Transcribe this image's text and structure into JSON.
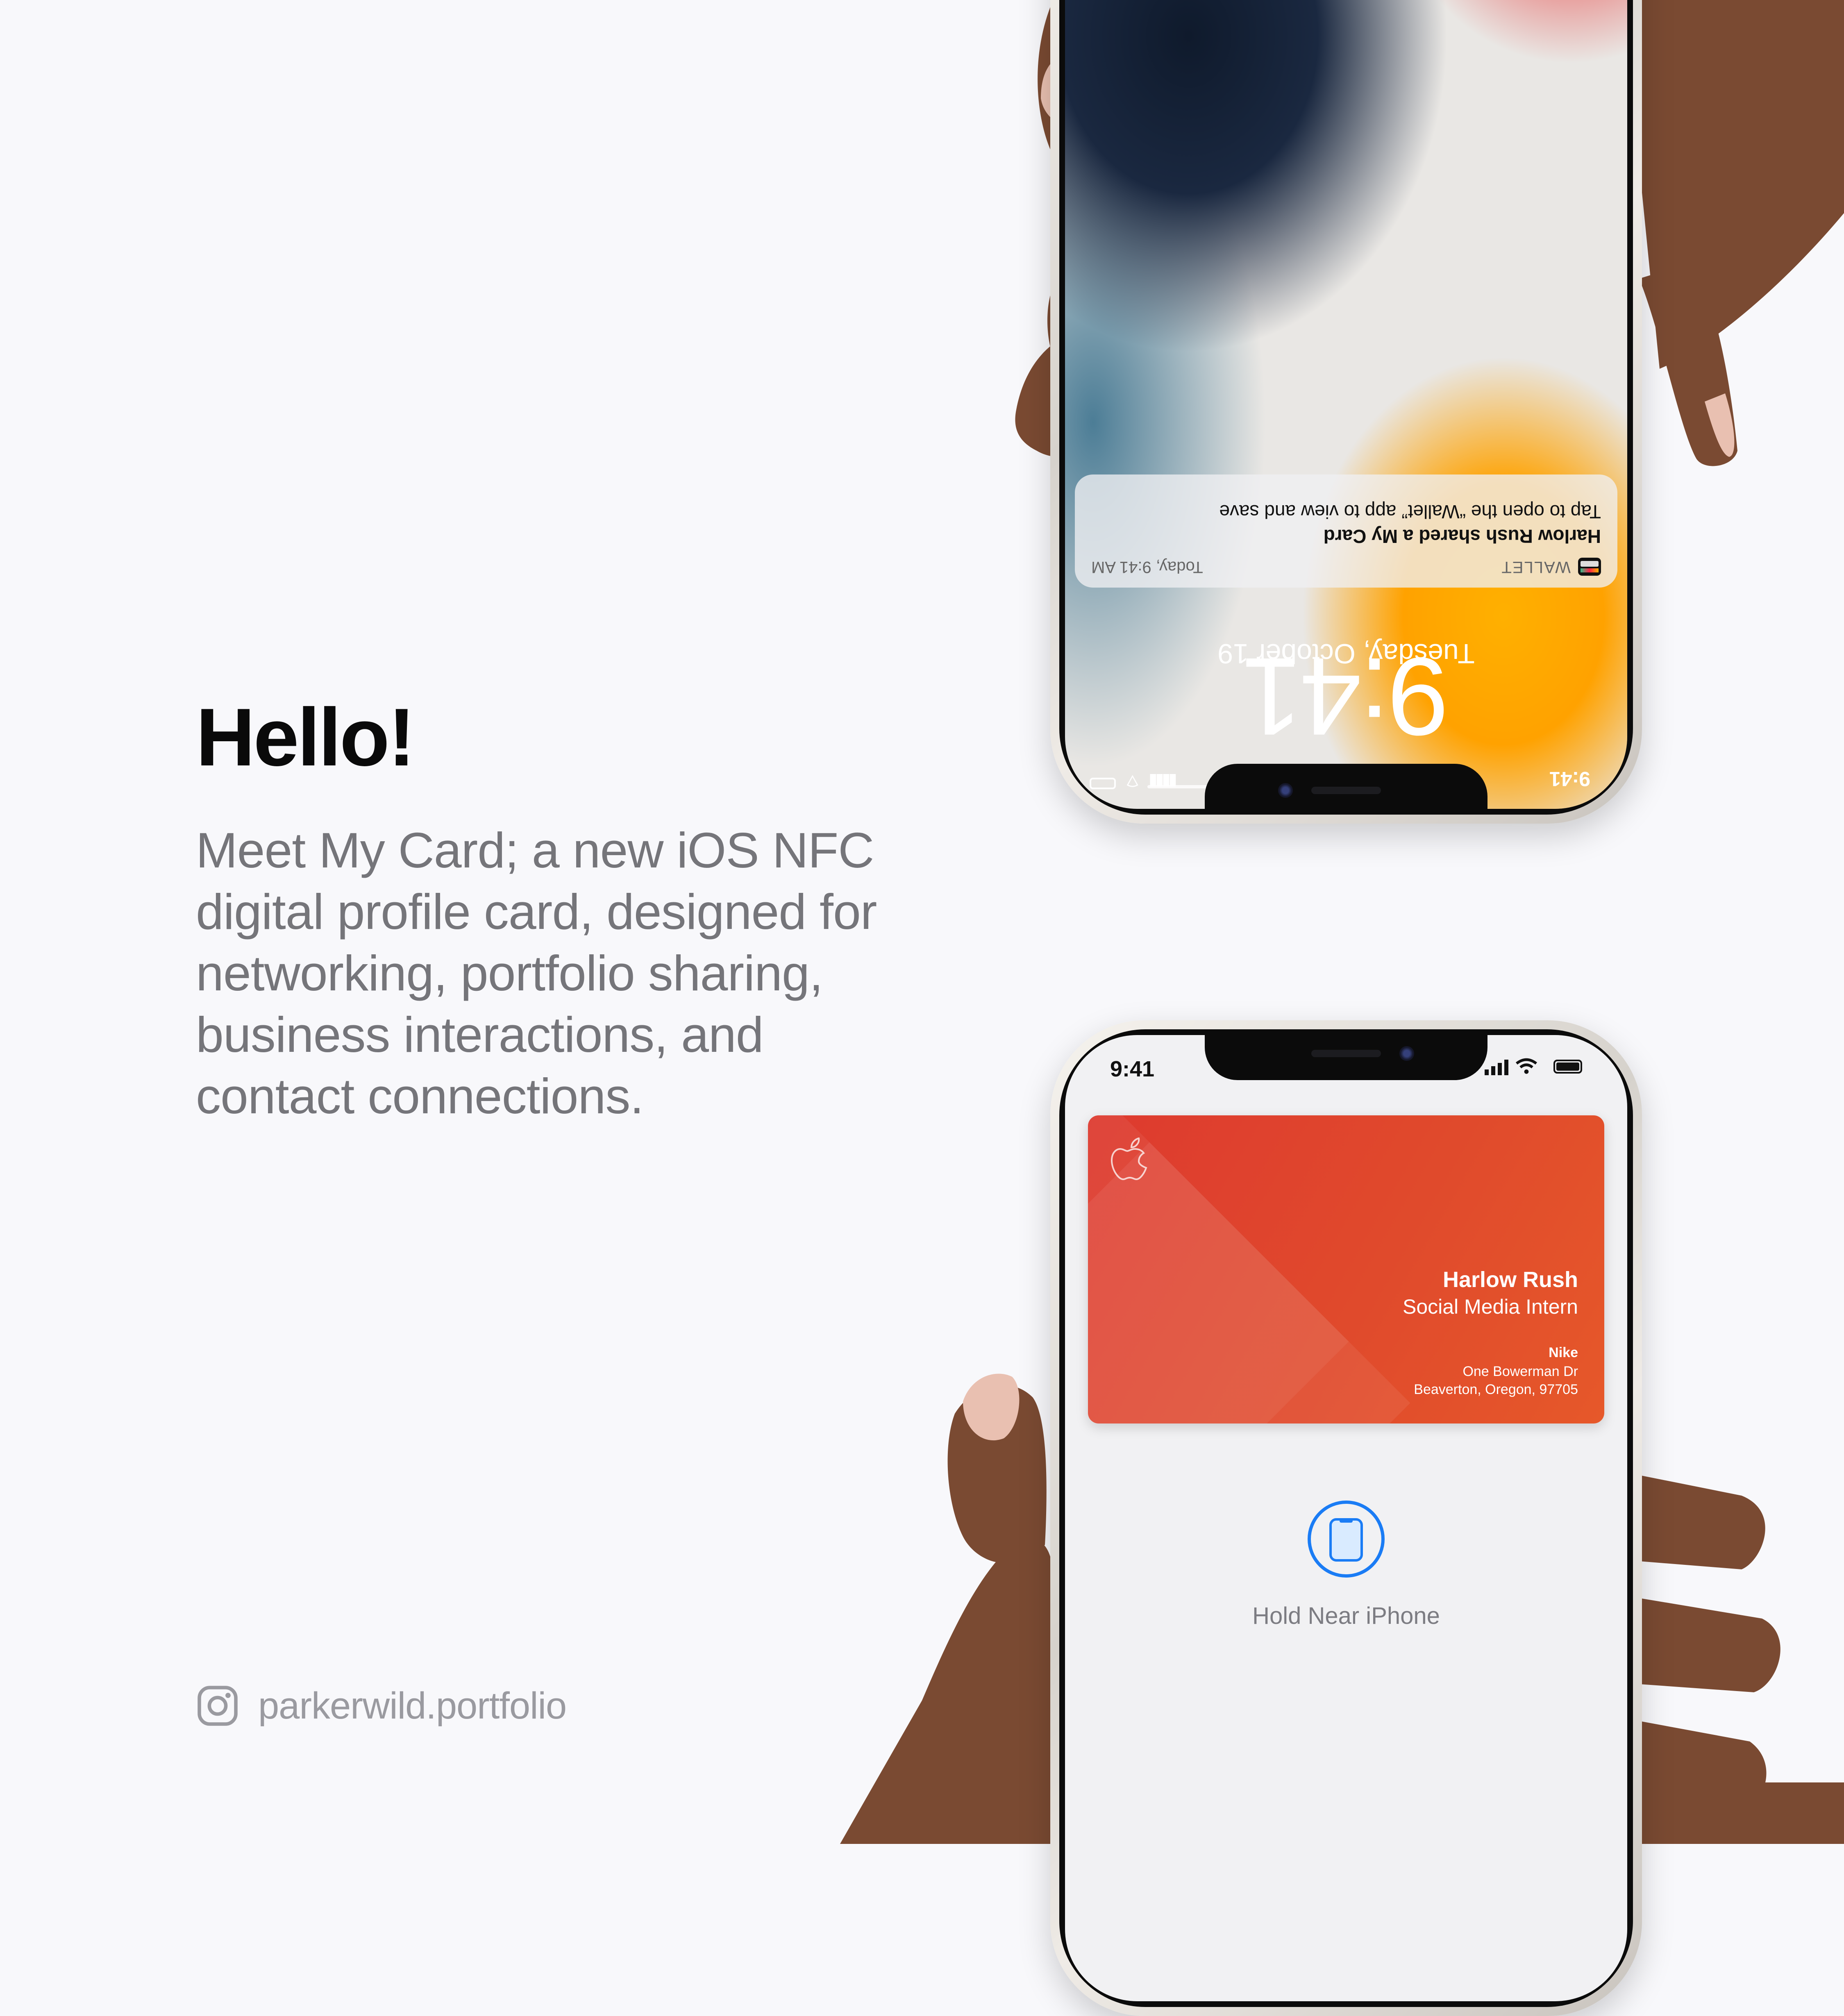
{
  "heading": "Hello!",
  "description": "Meet My Card; a new iOS NFC digital profile card, designed for networking, portfolio sharing, business interactions, and contact connections.",
  "social": {
    "icon": "instagram-icon",
    "handle": "parkerwild.portfolio"
  },
  "top_phone": {
    "orientation": "upside-down",
    "status_time": "9:41",
    "lock_time": "9:41",
    "date": "Tuesday, October 19",
    "notification": {
      "app": "WALLET",
      "time": "Today, 9:41 AM",
      "title": "Harlow Rush shared a My Card",
      "body": "Tap to open the “Wallet” app to view and save"
    }
  },
  "bottom_phone": {
    "status_time": "9:41",
    "card": {
      "logo": "apple-logo",
      "name": "Harlow Rush",
      "title": "Social Media Intern",
      "company": "Nike",
      "address_line1": "One Bowerman Dr",
      "address_line2": "Beaverton, Oregon, 97705",
      "color": "#de3a2f"
    },
    "nfc_icon": "iphone-outline-icon",
    "prompt": "Hold Near iPhone",
    "accent": "#1a7cf5"
  }
}
